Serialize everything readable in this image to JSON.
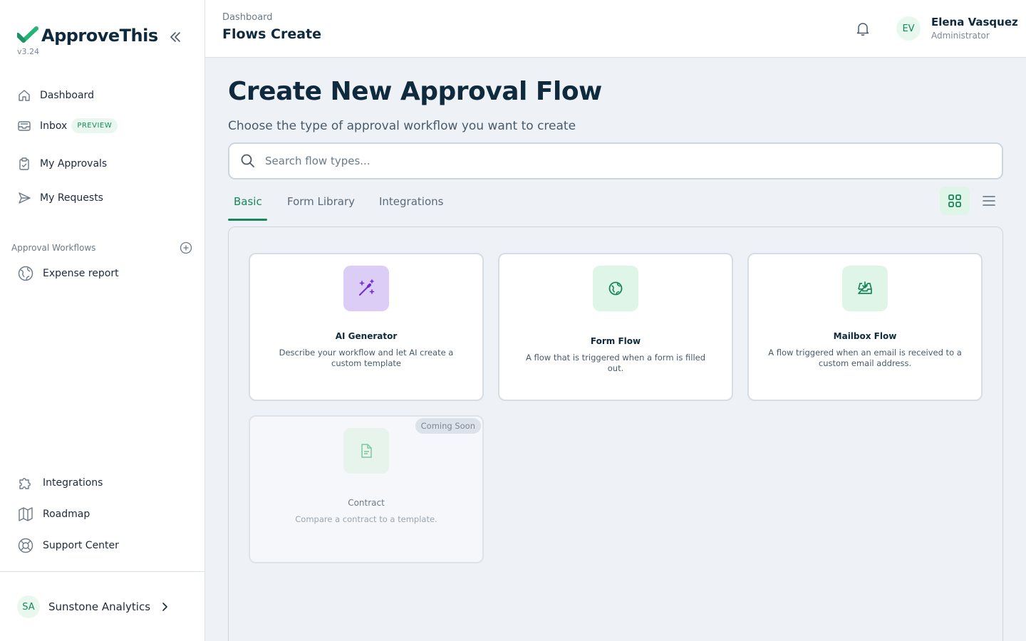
{
  "app": {
    "name": "ApproveThis",
    "version": "v3.24"
  },
  "colors": {
    "accent": "#17875a",
    "accent_light": "#e8f8ef",
    "ai_purple": "#7c3aed"
  },
  "sidebar": {
    "nav": [
      {
        "label": "Dashboard",
        "icon": "home-icon"
      },
      {
        "label": "Inbox",
        "icon": "inbox-icon",
        "badge": "PREVIEW"
      },
      {
        "label": "My Approvals",
        "icon": "clipboard-check-icon"
      },
      {
        "label": "My Requests",
        "icon": "send-icon"
      }
    ],
    "section_label": "Approval Workflows",
    "workflows": [
      {
        "label": "Expense report",
        "icon": "globe-icon"
      }
    ],
    "bottom_nav": [
      {
        "label": "Integrations",
        "icon": "puzzle-icon"
      },
      {
        "label": "Roadmap",
        "icon": "map-icon"
      },
      {
        "label": "Support Center",
        "icon": "lifebuoy-icon"
      }
    ],
    "org": {
      "initials": "SA",
      "name": "Sunstone Analytics"
    }
  },
  "header": {
    "breadcrumb": "Dashboard",
    "title": "Flows Create",
    "user": {
      "initials": "EV",
      "name": "Elena Vasquez",
      "role": "Administrator"
    }
  },
  "main": {
    "title": "Create New Approval Flow",
    "subtitle": "Choose the type of approval workflow you want to create",
    "search_placeholder": "Search flow types...",
    "tabs": [
      {
        "label": "Basic",
        "active": true
      },
      {
        "label": "Form Library",
        "active": false
      },
      {
        "label": "Integrations",
        "active": false
      }
    ],
    "view_mode": "grid",
    "cards": [
      {
        "title": "AI Generator",
        "description": "Describe your workflow and let AI create a custom template",
        "icon": "magic-wand-icon"
      },
      {
        "title": "Form Flow",
        "description": "A flow that is triggered when a form is filled out.",
        "icon": "globe-icon"
      },
      {
        "title": "Mailbox Flow",
        "description": "A flow triggered when an email is received to a custom email address.",
        "icon": "inbox-download-icon"
      },
      {
        "title": "Contract",
        "description": "Compare a contract to a template.",
        "icon": "document-icon",
        "badge": "Coming Soon",
        "disabled": true
      }
    ]
  }
}
